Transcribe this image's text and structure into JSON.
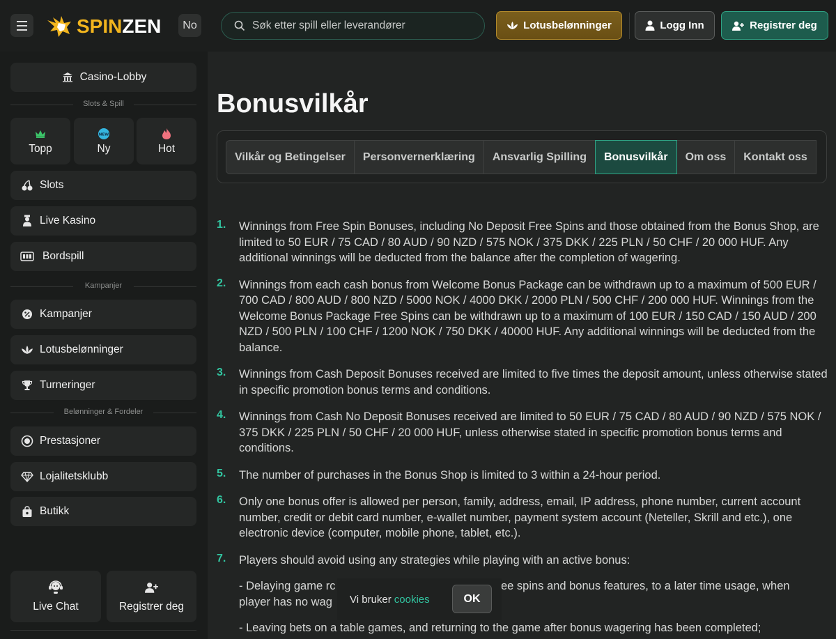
{
  "header": {
    "logo_left": "SPIN",
    "logo_right": "ZEN",
    "language": "No",
    "search_placeholder": "Søk etter spill eller leverandører",
    "lotus_label": "Lotusbelønninger",
    "login_label": "Logg Inn",
    "register_label": "Registrer deg"
  },
  "sidebar": {
    "lobby": "Casino-Lobby",
    "section_games": "Slots & Spill",
    "tiles": [
      {
        "label": "Topp",
        "icon": "crown-icon"
      },
      {
        "label": "Ny",
        "icon": "new-badge-icon",
        "badge": "NEW"
      },
      {
        "label": "Hot",
        "icon": "flame-icon"
      }
    ],
    "games": [
      {
        "label": "Slots",
        "icon": "cherries-icon"
      },
      {
        "label": "Live Kasino",
        "icon": "dealer-icon"
      },
      {
        "label": "Bordspill",
        "icon": "card-table-icon"
      }
    ],
    "section_campaigns": "Kampanjer",
    "campaigns": [
      {
        "label": "Kampanjer",
        "icon": "percent-icon"
      },
      {
        "label": "Lotusbelønninger",
        "icon": "lotus-icon"
      },
      {
        "label": "Turneringer",
        "icon": "trophy-icon"
      }
    ],
    "section_rewards": "Belønninger & Fordeler",
    "rewards": [
      {
        "label": "Prestasjoner",
        "icon": "medal-icon"
      },
      {
        "label": "Lojalitetsklubb",
        "icon": "diamond-icon"
      },
      {
        "label": "Butikk",
        "icon": "shop-bag-icon"
      }
    ],
    "live_chat": "Live Chat",
    "register": "Registrer deg"
  },
  "main": {
    "title": "Bonusvilkår",
    "tabs": [
      {
        "label": "Vilkår og Betingelser",
        "active": false
      },
      {
        "label": "Personvernerklæring",
        "active": false
      },
      {
        "label": "Ansvarlig Spilling",
        "active": false
      },
      {
        "label": "Bonusvilkår",
        "active": true
      },
      {
        "label": "Om oss",
        "active": false
      },
      {
        "label": "Kontakt oss",
        "active": false
      }
    ],
    "terms": [
      {
        "num": "1.",
        "text": "Winnings from Free Spin Bonuses, including No Deposit Free Spins and those obtained from the Bonus Shop, are limited to 50 EUR / 75 CAD / 80 AUD / 90 NZD / 575 NOK / 375 DKK / 225 PLN / 50 CHF / 20 000 HUF. Any additional winnings will be deducted from the balance after the completion of wagering."
      },
      {
        "num": "2.",
        "text": "Winnings from each cash bonus from Welcome Bonus Package can be withdrawn up to a maximum of 500 EUR / 700 CAD / 800 AUD / 800 NZD / 5000 NOK / 4000 DKK / 2000 PLN / 500 CHF / 200 000 HUF. Winnings from the Welcome Bonus Package Free Spins can be withdrawn up to a maximum of 100 EUR / 150 CAD / 150 AUD / 200 NZD / 500 PLN / 100 CHF / 1200 NOK / 750 DKK / 40000 HUF. Any additional winnings will be deducted from the balance."
      },
      {
        "num": "3.",
        "text": "Winnings from Cash Deposit Bonuses received are limited to five times the deposit amount, unless otherwise stated in specific promotion bonus terms and conditions."
      },
      {
        "num": "4.",
        "text": "Winnings from Cash No Deposit Bonuses received are limited to 50 EUR / 75 CAD / 80 AUD / 90 NZD / 575 NOK / 375 DKK / 225 PLN / 50 CHF / 20 000 HUF, unless otherwise stated in specific promotion bonus terms and conditions."
      },
      {
        "num": "5.",
        "text": "The number of purchases in the Bonus Shop is limited to 3 within a 24-hour period."
      },
      {
        "num": "6.",
        "text": "Only one bonus offer is allowed per person, family, address, email, IP address, phone number, current account number, credit or debit card number, e-wallet number, payment system account (Neteller, Skrill and etc.), one electronic device (computer, mobile phone, tablet, etc.)."
      },
      {
        "num": "7.",
        "text": "Players should avoid using any strategies while playing with an active bonus:"
      }
    ],
    "sub_1_start": "- Delaying game rc",
    "sub_1_end": "ree spins and bonus features, to a later time usage, when",
    "sub_1_line2": "player has no wag",
    "sub_2": "- Leaving bets on a table games, and returning to the game after bonus wagering has been completed;"
  },
  "cookie": {
    "text": "Vi bruker",
    "link": "cookies",
    "ok": "OK"
  },
  "colors": {
    "accent": "#32c4a0",
    "brand_gold": "#f2b51e",
    "active_tab": "#1c4a40"
  }
}
